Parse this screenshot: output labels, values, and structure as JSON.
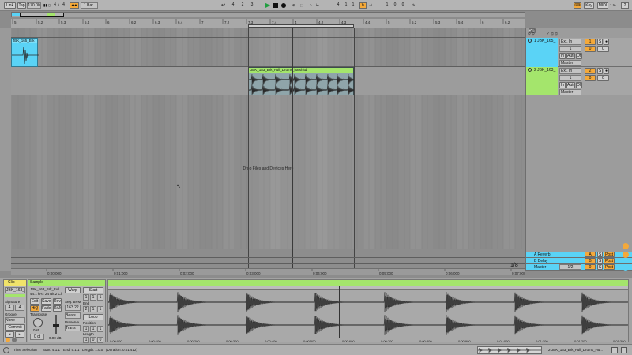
{
  "colors": {
    "clip_blue": "#5ad3f6",
    "clip_green": "#a4e56c",
    "accent_orange": "#f4a93a",
    "waveform_dark": "#2a2a2a"
  },
  "transport": {
    "link_label": "Link",
    "tap_label": "Tap",
    "tempo": "170.00",
    "time_sig_num": "4",
    "time_sig_den": "4",
    "quantize": "1 Bar",
    "position": [
      "4",
      "2",
      "3"
    ],
    "loop_start": [
      "4",
      "1",
      "1"
    ],
    "loop_length": [
      "1",
      "0",
      "0"
    ],
    "key_label": "Key",
    "midi_label": "MIDI",
    "cpu": "1 %",
    "counter_badge": "2"
  },
  "ruler": {
    "bars": [
      "5",
      "5.2",
      "5.3",
      "5.4",
      "6",
      "6.2",
      "6.3",
      "6.4",
      "7",
      "7.2",
      "7.3",
      "7.4",
      "4",
      "4.2",
      "4.3",
      "4.4",
      "5",
      "5.2",
      "5.3",
      "5.4",
      "6",
      "6.2"
    ]
  },
  "timeline": {
    "times": [
      "0:00:000",
      "0:01:000",
      "0:02:000",
      "0:03:000",
      "0:04:000",
      "0:05:000",
      "0:06:000",
      "0:07:000"
    ]
  },
  "arrangement": {
    "clip1_label": "JBK_165_Brk",
    "clip2_label": "JBK_163_Brk_Full_Drums_hatshitd",
    "drop_text": "Drop Files and Devices Here",
    "zoom": "1/8"
  },
  "mixer": {
    "set_label": "Set",
    "tracks": [
      {
        "name": "1 JBK_165_",
        "input": "Ext. In",
        "sub_input": "1",
        "monitor_in": "In",
        "monitor_auto": "Auto",
        "monitor_off": "Off",
        "output": "Master",
        "volume": "0",
        "pan": "C",
        "number": "1",
        "solo": "S"
      },
      {
        "name": "2 JBK_163_",
        "input": "Ext. In",
        "sub_input": "1",
        "monitor_in": "In",
        "monitor_auto": "Auto",
        "monitor_off": "Off",
        "output": "Master",
        "volume": "0",
        "pan": "C",
        "number": "2",
        "solo": "S"
      }
    ],
    "returns": [
      {
        "name": "A Reverb",
        "letter": "A",
        "solo": "S",
        "post": "Post"
      },
      {
        "name": "B Delay",
        "letter": "B",
        "solo": "S",
        "post": "Post"
      },
      {
        "name": "Master",
        "selector": "1/2",
        "letter": "0",
        "solo": "S",
        "post": "Post"
      }
    ]
  },
  "clip_panel": {
    "clip_tab": "Clip",
    "clip_name": "JBK_163_Br",
    "signature_label": "Signature",
    "sig_num": "4",
    "sig_den": "4",
    "groove_label": "Groove",
    "groove_value": "None",
    "commit_label": "Commit",
    "sample_tab": "Sample",
    "sample_name": "JBK_163_Brk_Full",
    "sample_info": "44.1 kHz 24 Bit 2 Ch",
    "edit_btn": "Edit",
    "save_btn": "Save",
    "rev_btn": "Rev",
    "hiq_btn": "HiQ",
    "fade_btn": "Fade",
    "ram_btn": "RAM",
    "transpose_label": "Transpose",
    "transpose_value": "0 st",
    "detune_value": "0 ct",
    "gain_value": "0.00 dB",
    "warp_btn": "Warp",
    "segbpm_label": "Seg. BPM",
    "segbpm_value": "163.22",
    "beats_label": "Beats",
    "preserve_label": "Preserve",
    "preserve_value": "Trans",
    "start_label": "Start",
    "start_value": [
      "1",
      "1",
      "1"
    ],
    "end_label": "End",
    "end_value": [
      "2",
      "1",
      "1"
    ],
    "loop_label": "Loop",
    "position_label": "Position",
    "position_value": [
      "1",
      "1",
      "1"
    ],
    "length_label": "Length",
    "length_value": [
      "1",
      "0",
      "0"
    ],
    "set_label": "Set",
    "time_ticks": [
      "0:00:000",
      "0:00:100",
      "0:00:200",
      "0:00:300",
      "0:00:400",
      "0:00:500",
      "0:00:600",
      "0:00:700",
      "0:00:800",
      "0:00:900",
      "0:01:000",
      "0:01:100",
      "0:01:200",
      "0:01:300"
    ]
  },
  "status": {
    "time_selection": "Time Selection",
    "start": "Start: 4.1.1",
    "end": "End: 5.1.1",
    "length": "Length: 1.0.0",
    "duration": "(Duration: 0:01.412)",
    "right_clip": "2-JBK_163_Brk_Full_Drums_Hu..."
  }
}
